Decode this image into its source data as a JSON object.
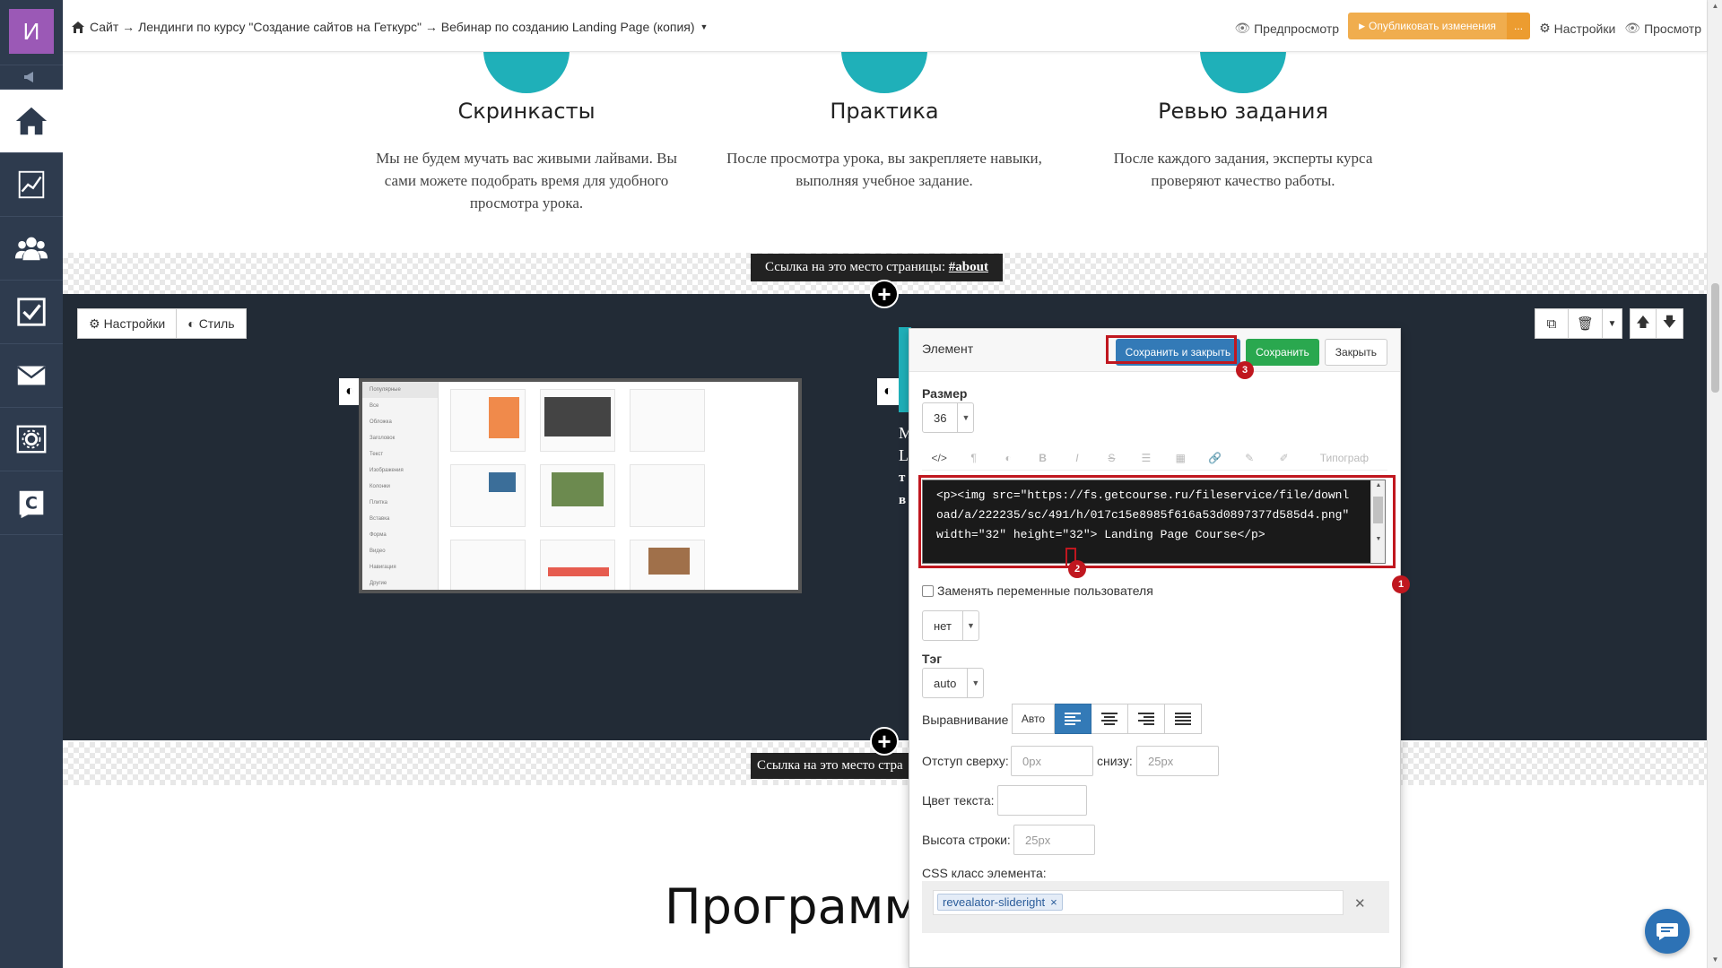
{
  "sidebar": {
    "logo_letter": "И",
    "items": [
      {
        "icon": "home-icon",
        "active": true
      },
      {
        "icon": "chart-icon"
      },
      {
        "icon": "users-icon"
      },
      {
        "icon": "checkbox-icon"
      },
      {
        "icon": "mail-icon"
      },
      {
        "icon": "settings-box-icon"
      },
      {
        "icon": "getcourse-logo-icon"
      }
    ]
  },
  "topbar": {
    "breadcrumb": "Сайт → Лендинги по курсу \"Создание сайтов на Геткурс\" → Вебинар по созданию Landing Page (копия)",
    "preview": "Предпросмотр",
    "publish": "Опубликовать изменения",
    "publish_more": "...",
    "settings": "Настройки",
    "view": "Просмотр"
  },
  "features": [
    {
      "title": "Скринкасты",
      "text": "Мы не будем мучать вас живыми лайвами. Вы сами можете подобрать время для удобного просмотра урока."
    },
    {
      "title": "Практика",
      "text": "После просмотра урока, вы закрепляете навыки, выполняя учебное задание."
    },
    {
      "title": "Ревью задания",
      "text": "После каждого задания, эксперты курса проверяют качество работы."
    }
  ],
  "anchor": {
    "prefix": "Ссылка на это место страницы:",
    "link": "#about",
    "prefix_cut": "Ссылка на это место стра"
  },
  "block_buttons": {
    "settings": "Настройки",
    "style": "Стиль"
  },
  "dark_text": {
    "letter1": "L",
    "letter2": "M",
    "letter3": "L",
    "letter4": "т",
    "letter5": "в"
  },
  "screenshot_menu": [
    "Популярные",
    "Все",
    "Обложка",
    "Заголовок",
    "Текст",
    "Изображения",
    "Колонки",
    "Плитка",
    "Вставка",
    "Форма",
    "Видео",
    "Навигация",
    "Другие"
  ],
  "program_heading": "Программ",
  "panel": {
    "title": "Элемент",
    "save_close": "Сохранить и закрыть",
    "save": "Сохранить",
    "close": "Закрыть",
    "size_label": "Размер",
    "size_value": "36",
    "toolbar_typograph": "Типограф",
    "code": "<p><img src=\"https://fs.getcourse.ru/fileservice/file/download/a/222235/sc/491/h/017c15e8985f616a53d0897377d585d4.png\" width=\"32\" height=\"32\"> Landing Page Course</p>",
    "replace_vars": "Заменять переменные пользователя",
    "replace_value": "нет",
    "tag_label": "Тэг",
    "tag_value": "auto",
    "align_label": "Выравнивание",
    "align_auto": "Авто",
    "padding_top_label": "Отступ сверху:",
    "padding_top_placeholder": "0px",
    "padding_bottom_label": "снизу:",
    "padding_bottom_placeholder": "25px",
    "text_color_label": "Цвет текста:",
    "line_height_label": "Высота строки:",
    "line_height_placeholder": "25px",
    "css_class_label": "CSS класс элемента:",
    "css_tag": "revealator-slideright",
    "badges": [
      "1",
      "2",
      "3"
    ]
  },
  "colors": {
    "accent_teal": "#1fb0b9",
    "sidebar_bg": "#2e3b4e",
    "highlight_red": "#c0171f",
    "publish_orange": "#f0ad4e"
  }
}
